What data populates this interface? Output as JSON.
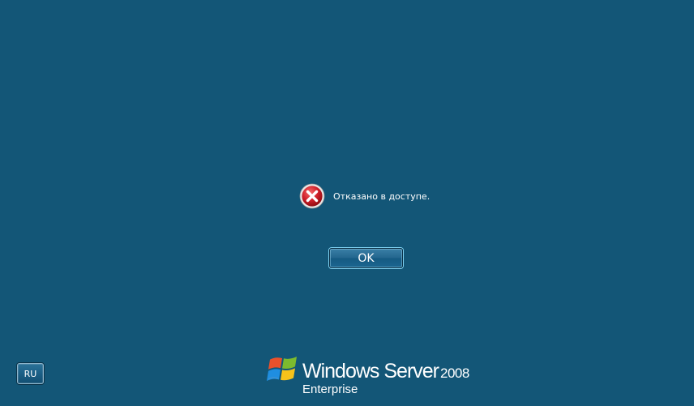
{
  "dialog": {
    "message": "Отказано в доступе.",
    "icon": "error-icon",
    "ok_label": "OK"
  },
  "language_indicator": {
    "label": "RU"
  },
  "branding": {
    "product_name": "Windows Server",
    "version": "2008",
    "edition": "Enterprise",
    "logo_icon": "windows-flag-logo"
  },
  "colors": {
    "background": "#135677",
    "error_red": "#c4161c",
    "button_glow": "#7fd2f2"
  }
}
